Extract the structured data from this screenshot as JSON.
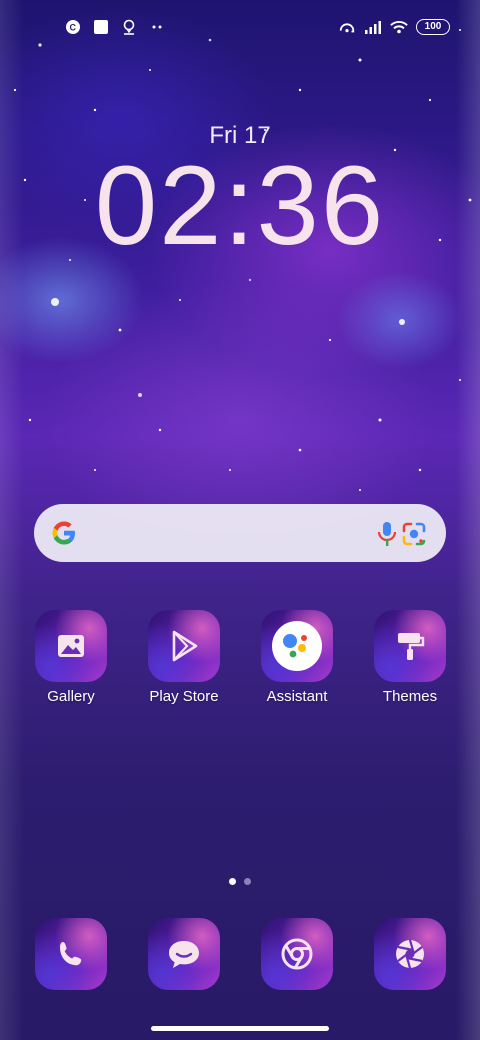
{
  "status_bar": {
    "left_icons": [
      "app-notification-icon",
      "square-notification-icon",
      "location-icon",
      "more-dots-icon"
    ],
    "right_icons": [
      "hotspot-icon",
      "signal-icon",
      "wifi-icon"
    ],
    "battery": "100"
  },
  "lockscreen": {
    "date": "Fri 17",
    "time": "02:36"
  },
  "search": {
    "icons": [
      "google-g-icon",
      "mic-icon",
      "google-lens-icon"
    ]
  },
  "apps": [
    {
      "label": "Gallery",
      "icon": "gallery-icon"
    },
    {
      "label": "Play Store",
      "icon": "play-store-icon"
    },
    {
      "label": "Assistant",
      "icon": "assistant-icon"
    },
    {
      "label": "Themes",
      "icon": "themes-icon"
    }
  ],
  "dock": [
    {
      "icon": "phone-icon"
    },
    {
      "icon": "messages-icon"
    },
    {
      "icon": "chrome-icon"
    },
    {
      "icon": "camera-icon"
    }
  ],
  "page_indicator": {
    "pages": 2,
    "current": 1
  },
  "colors": {
    "accent_text": "#f6e3ec",
    "dot_active": "#ffffff",
    "dot_inactive": "#8e82b8"
  }
}
